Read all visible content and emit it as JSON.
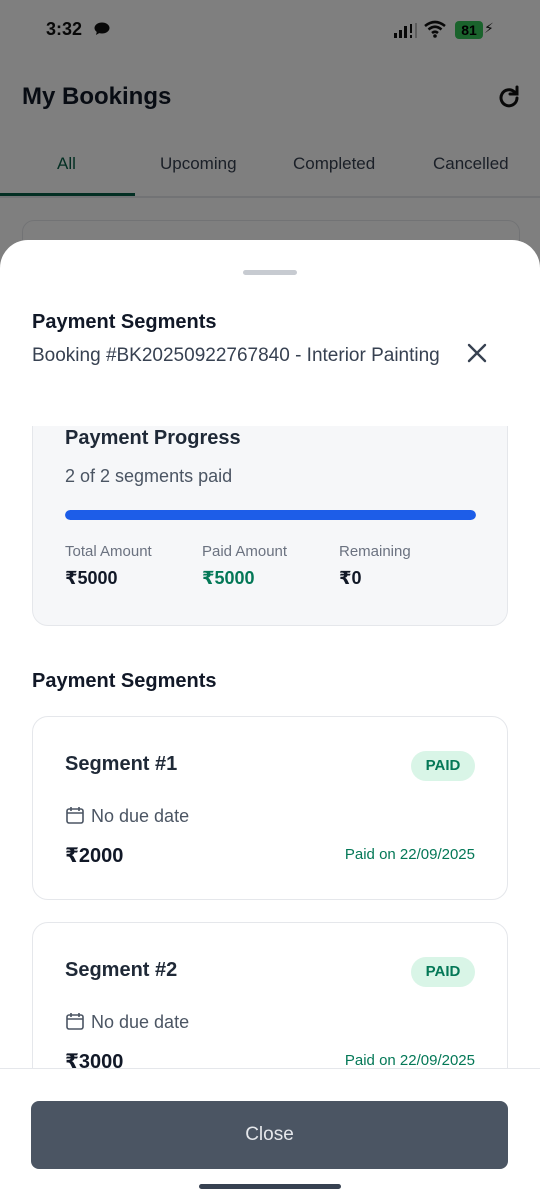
{
  "status_bar": {
    "time": "3:32",
    "battery": "81"
  },
  "app": {
    "title": "My Bookings",
    "tabs": [
      "All",
      "Upcoming",
      "Completed",
      "Cancelled"
    ],
    "active_tab": "All"
  },
  "sheet": {
    "title": "Payment Segments",
    "subtitle": "Booking #BK20250922767840 - Interior Painting",
    "progress": {
      "title": "Payment Progress",
      "summary": "2 of 2 segments paid",
      "fraction": 1.0,
      "total_label": "Total Amount",
      "total_value": "₹5000",
      "paid_label": "Paid Amount",
      "paid_value": "₹5000",
      "remaining_label": "Remaining",
      "remaining_value": "₹0"
    },
    "segments_title": "Payment Segments",
    "segments": [
      {
        "title": "Segment #1",
        "status": "PAID",
        "due": "No due date",
        "amount": "₹2000",
        "paid_on": "Paid on 22/09/2025"
      },
      {
        "title": "Segment #2",
        "status": "PAID",
        "due": "No due date",
        "amount": "₹3000",
        "paid_on": "Paid on 22/09/2025"
      }
    ],
    "close_label": "Close"
  },
  "colors": {
    "accent_green": "#047857",
    "progress_blue": "#1d5de8",
    "badge_bg": "#d9f5e7",
    "button_bg": "#4b5563"
  }
}
